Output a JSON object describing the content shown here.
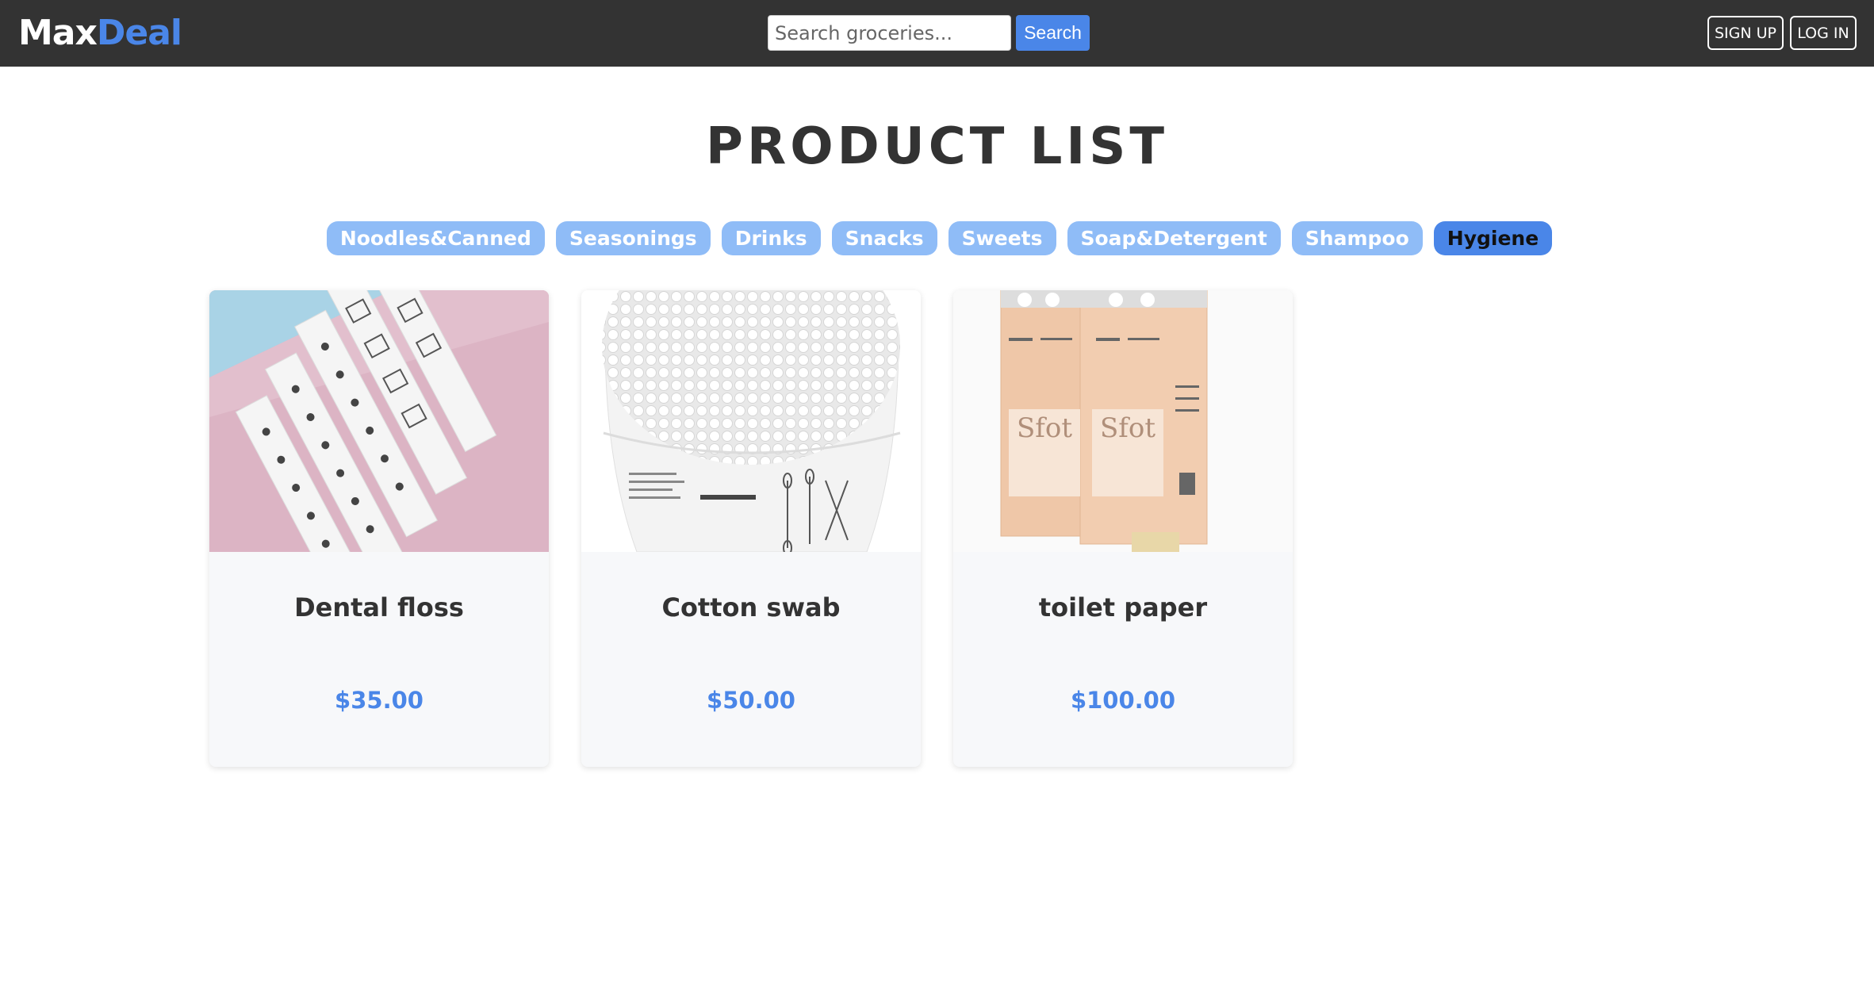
{
  "header": {
    "logo_part1": "Max",
    "logo_part2": "Deal",
    "search_placeholder": "Search groceries...",
    "search_button": "Search",
    "signup_button": "SIGN UP",
    "login_button": "LOG IN"
  },
  "page_title": "PRODUCT LIST",
  "categories": [
    {
      "label": "Noodles&Canned",
      "active": false
    },
    {
      "label": "Seasonings",
      "active": false
    },
    {
      "label": "Drinks",
      "active": false
    },
    {
      "label": "Snacks",
      "active": false
    },
    {
      "label": "Sweets",
      "active": false
    },
    {
      "label": "Soap&Detergent",
      "active": false
    },
    {
      "label": "Shampoo",
      "active": false
    },
    {
      "label": "Hygiene",
      "active": true
    }
  ],
  "products": [
    {
      "name": "Dental floss",
      "price": "$35.00",
      "image": "dental-floss-image"
    },
    {
      "name": "Cotton swab",
      "price": "$50.00",
      "image": "cotton-swab-image"
    },
    {
      "name": "toilet paper",
      "price": "$100.00",
      "image": "toilet-paper-image"
    }
  ],
  "colors": {
    "navbar": "#333333",
    "accent": "#4a86e8",
    "category_inactive": "#8fbcf7",
    "card_bg": "#f7f8fa"
  }
}
